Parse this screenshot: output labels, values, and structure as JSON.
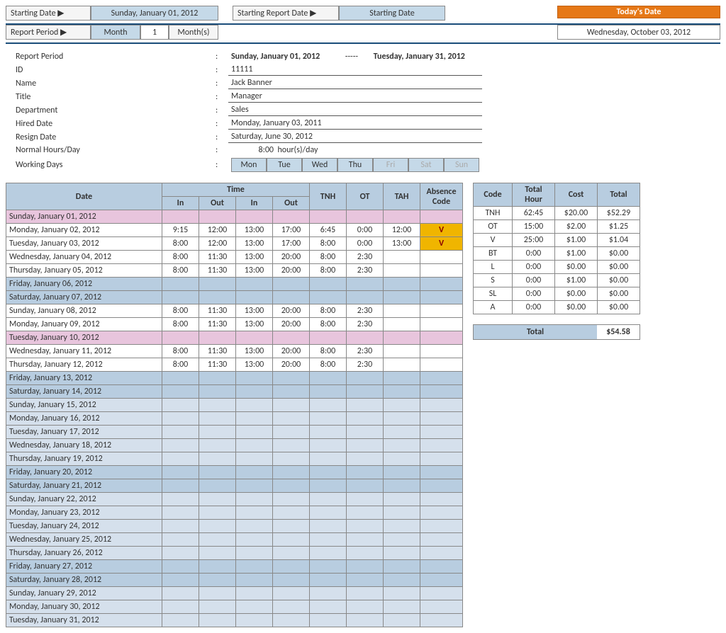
{
  "header": {
    "starting_date_label": "Starting Date ▶",
    "starting_date_value": "Sunday, January 01, 2012",
    "starting_report_label": "Starting Report Date ▶",
    "starting_report_value": "Starting Date",
    "today_label": "Today's Date",
    "today_value": "Wednesday, October 03, 2012",
    "report_period_label": "Report Period ▶",
    "period_type": "Month",
    "period_num": "1",
    "period_unit": "Month(s)"
  },
  "info": {
    "report_period_label": "Report Period",
    "report_period_from": "Sunday, January 01, 2012",
    "report_period_dash": "-----",
    "report_period_to": "Tuesday, January 31, 2012",
    "id_label": "ID",
    "id_value": "11111",
    "name_label": "Name",
    "name_value": "Jack Banner",
    "title_label": "Title",
    "title_value": "Manager",
    "department_label": "Department",
    "department_value": "Sales",
    "hired_label": "Hired Date",
    "hired_value": "Monday, January 03, 2011",
    "resign_label": "Resign Date",
    "resign_value": "Saturday, June 30, 2012",
    "hours_label": "Normal Hours/Day",
    "hours_value": "8:00",
    "hours_unit": "hour(s)/day",
    "working_days_label": "Working Days",
    "days": [
      "Mon",
      "Tue",
      "Wed",
      "Thu",
      "Fri",
      "Sat",
      "Sun"
    ]
  },
  "timesheet": {
    "cols": {
      "date": "Date",
      "time": "Time",
      "in": "In",
      "out": "Out",
      "tnh": "TNH",
      "ot": "OT",
      "tah": "TAH",
      "abs": "Absence Code"
    },
    "rows": [
      {
        "date": "Sunday, January 01, 2012",
        "cls": "row-pink"
      },
      {
        "date": "Monday, January 02, 2012",
        "in1": "9:15",
        "out1": "12:00",
        "in2": "13:00",
        "out2": "17:00",
        "tnh": "6:45",
        "ot": "0:00",
        "tah": "12:00",
        "code": "V"
      },
      {
        "date": "Tuesday, January 03, 2012",
        "in1": "8:00",
        "out1": "12:00",
        "in2": "13:00",
        "out2": "17:00",
        "tnh": "8:00",
        "ot": "0:00",
        "tah": "13:00",
        "code": "V"
      },
      {
        "date": "Wednesday, January 04, 2012",
        "in1": "8:00",
        "out1": "11:30",
        "in2": "13:00",
        "out2": "20:00",
        "tnh": "8:00",
        "ot": "2:30"
      },
      {
        "date": "Thursday, January 05, 2012",
        "in1": "8:00",
        "out1": "11:30",
        "in2": "13:00",
        "out2": "20:00",
        "tnh": "8:00",
        "ot": "2:30"
      },
      {
        "date": "Friday, January 06, 2012",
        "cls": "row-blue"
      },
      {
        "date": "Saturday, January 07, 2012",
        "cls": "row-blue"
      },
      {
        "date": "Sunday, January 08, 2012",
        "in1": "8:00",
        "out1": "11:30",
        "in2": "13:00",
        "out2": "20:00",
        "tnh": "8:00",
        "ot": "2:30"
      },
      {
        "date": "Monday, January 09, 2012",
        "in1": "8:00",
        "out1": "11:30",
        "in2": "13:00",
        "out2": "20:00",
        "tnh": "8:00",
        "ot": "2:30"
      },
      {
        "date": "Tuesday, January 10, 2012",
        "cls": "row-pink"
      },
      {
        "date": "Wednesday, January 11, 2012",
        "in1": "8:00",
        "out1": "11:30",
        "in2": "13:00",
        "out2": "20:00",
        "tnh": "8:00",
        "ot": "2:30"
      },
      {
        "date": "Thursday, January 12, 2012",
        "in1": "8:00",
        "out1": "11:30",
        "in2": "13:00",
        "out2": "20:00",
        "tnh": "8:00",
        "ot": "2:30"
      },
      {
        "date": "Friday, January 13, 2012",
        "cls": "row-blue"
      },
      {
        "date": "Saturday, January 14, 2012",
        "cls": "row-blue"
      },
      {
        "date": "Sunday, January 15, 2012",
        "cls": "row-lightblue"
      },
      {
        "date": "Monday, January 16, 2012",
        "cls": "row-lightblue"
      },
      {
        "date": "Tuesday, January 17, 2012",
        "cls": "row-lightblue"
      },
      {
        "date": "Wednesday, January 18, 2012",
        "cls": "row-lightblue"
      },
      {
        "date": "Thursday, January 19, 2012",
        "cls": "row-lightblue"
      },
      {
        "date": "Friday, January 20, 2012",
        "cls": "row-blue"
      },
      {
        "date": "Saturday, January 21, 2012",
        "cls": "row-blue"
      },
      {
        "date": "Sunday, January 22, 2012",
        "cls": "row-lightblue"
      },
      {
        "date": "Monday, January 23, 2012",
        "cls": "row-lightblue"
      },
      {
        "date": "Tuesday, January 24, 2012",
        "cls": "row-lightblue"
      },
      {
        "date": "Wednesday, January 25, 2012",
        "cls": "row-lightblue"
      },
      {
        "date": "Thursday, January 26, 2012",
        "cls": "row-lightblue"
      },
      {
        "date": "Friday, January 27, 2012",
        "cls": "row-blue"
      },
      {
        "date": "Saturday, January 28, 2012",
        "cls": "row-blue"
      },
      {
        "date": "Sunday, January 29, 2012",
        "cls": "row-lightblue"
      },
      {
        "date": "Monday, January 30, 2012",
        "cls": "row-lightblue"
      },
      {
        "date": "Tuesday, January 31, 2012",
        "cls": "row-lightblue"
      }
    ]
  },
  "summary": {
    "cols": {
      "code": "Code",
      "total_hour": "Total Hour",
      "cost": "Cost",
      "total": "Total"
    },
    "rows": [
      {
        "code": "TNH",
        "hour": "62:45",
        "cost": "$20.00",
        "total": "$52.29"
      },
      {
        "code": "OT",
        "hour": "15:00",
        "cost": "$2.00",
        "total": "$1.25"
      },
      {
        "code": "V",
        "hour": "25:00",
        "cost": "$1.00",
        "total": "$1.04"
      },
      {
        "code": "BT",
        "hour": "0:00",
        "cost": "$1.00",
        "total": "$0.00"
      },
      {
        "code": "L",
        "hour": "0:00",
        "cost": "$0.00",
        "total": "$0.00"
      },
      {
        "code": "S",
        "hour": "0:00",
        "cost": "$1.00",
        "total": "$0.00"
      },
      {
        "code": "SL",
        "hour": "0:00",
        "cost": "$0.00",
        "total": "$0.00"
      },
      {
        "code": "A",
        "hour": "0:00",
        "cost": "$0.00",
        "total": "$0.00"
      }
    ],
    "grand_total_label": "Total",
    "grand_total_value": "$54.58"
  }
}
